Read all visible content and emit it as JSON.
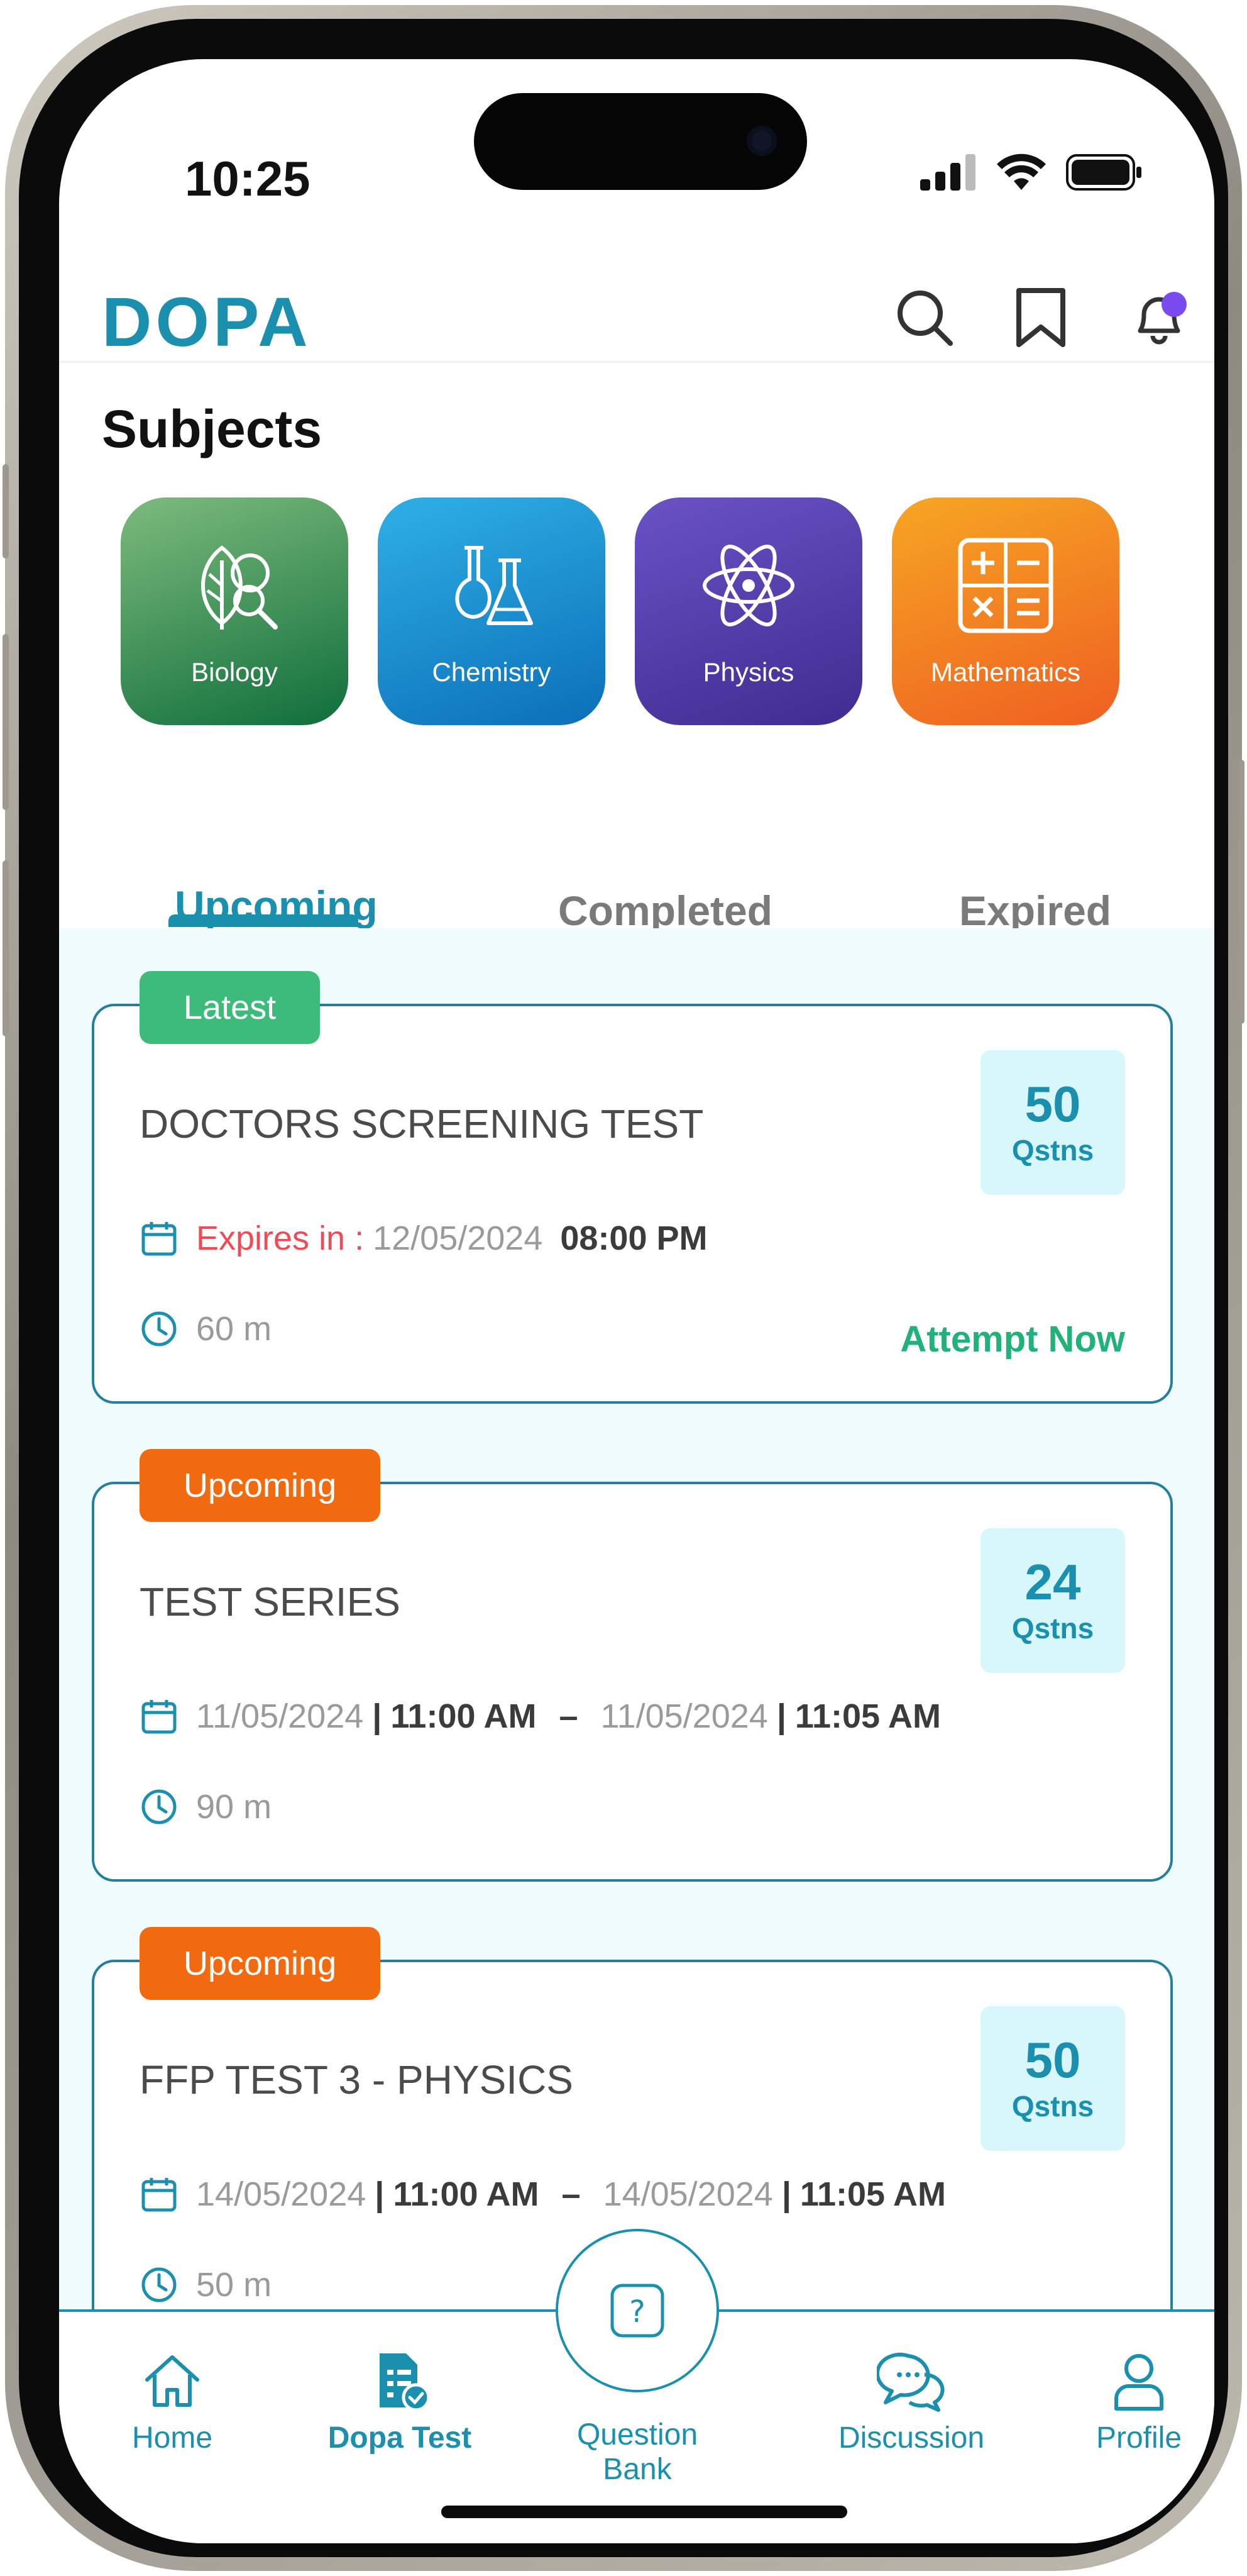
{
  "status": {
    "time": "10:25"
  },
  "header": {
    "logo": "DOPA"
  },
  "subjects": {
    "title": "Subjects",
    "items": [
      {
        "label": "Biology",
        "icon": "biology-icon",
        "colors": [
          "#7dbb7e",
          "#0f6e3a"
        ]
      },
      {
        "label": "Chemistry",
        "icon": "chemistry-icon",
        "colors": [
          "#2fb0e6",
          "#0b6fb8"
        ]
      },
      {
        "label": "Physics",
        "icon": "atom-icon",
        "colors": [
          "#6a52c6",
          "#3f2c90"
        ]
      },
      {
        "label": "Mathematics",
        "icon": "calculator-icon",
        "colors": [
          "#f6a623",
          "#ef5f22"
        ]
      }
    ]
  },
  "tabs": {
    "upcoming": "Upcoming",
    "completed": "Completed",
    "expired": "Expired"
  },
  "tests": [
    {
      "badge": "Latest",
      "badge_color": "#3dbb7a",
      "title": "DOCTORS SCREENING TEST",
      "questions": "50",
      "questions_label": "Qstns",
      "expires_label": "Expires in :",
      "expires_date": "12/05/2024",
      "expires_time": "08:00 PM",
      "duration": "60 m",
      "action": "Attempt Now"
    },
    {
      "badge": "Upcoming",
      "badge_color": "#f26a10",
      "title": "TEST SERIES",
      "questions": "24",
      "questions_label": "Qstns",
      "start_date": "11/05/2024",
      "start_time": "11:00 AM",
      "dash": "–",
      "end_date": "11/05/2024",
      "end_time": "11:05 AM",
      "duration": "90 m"
    },
    {
      "badge": "Upcoming",
      "badge_color": "#f26a10",
      "title": "FFP  TEST 3 - PHYSICS",
      "questions": "50",
      "questions_label": "Qstns",
      "start_date": "14/05/2024",
      "start_time": "11:00 AM",
      "dash": "–",
      "end_date": "14/05/2024",
      "end_time": "11:05 AM",
      "duration": "50 m"
    }
  ],
  "nav": {
    "home": "Home",
    "dopa_test": "Dopa Test",
    "question_bank": "Question Bank",
    "discussion": "Discussion",
    "profile": "Profile"
  },
  "colors": {
    "accent": "#1a8fae",
    "notification_dot": "#7a4cf0",
    "attempt": "#22b17a",
    "expires": "#ef4b56"
  }
}
